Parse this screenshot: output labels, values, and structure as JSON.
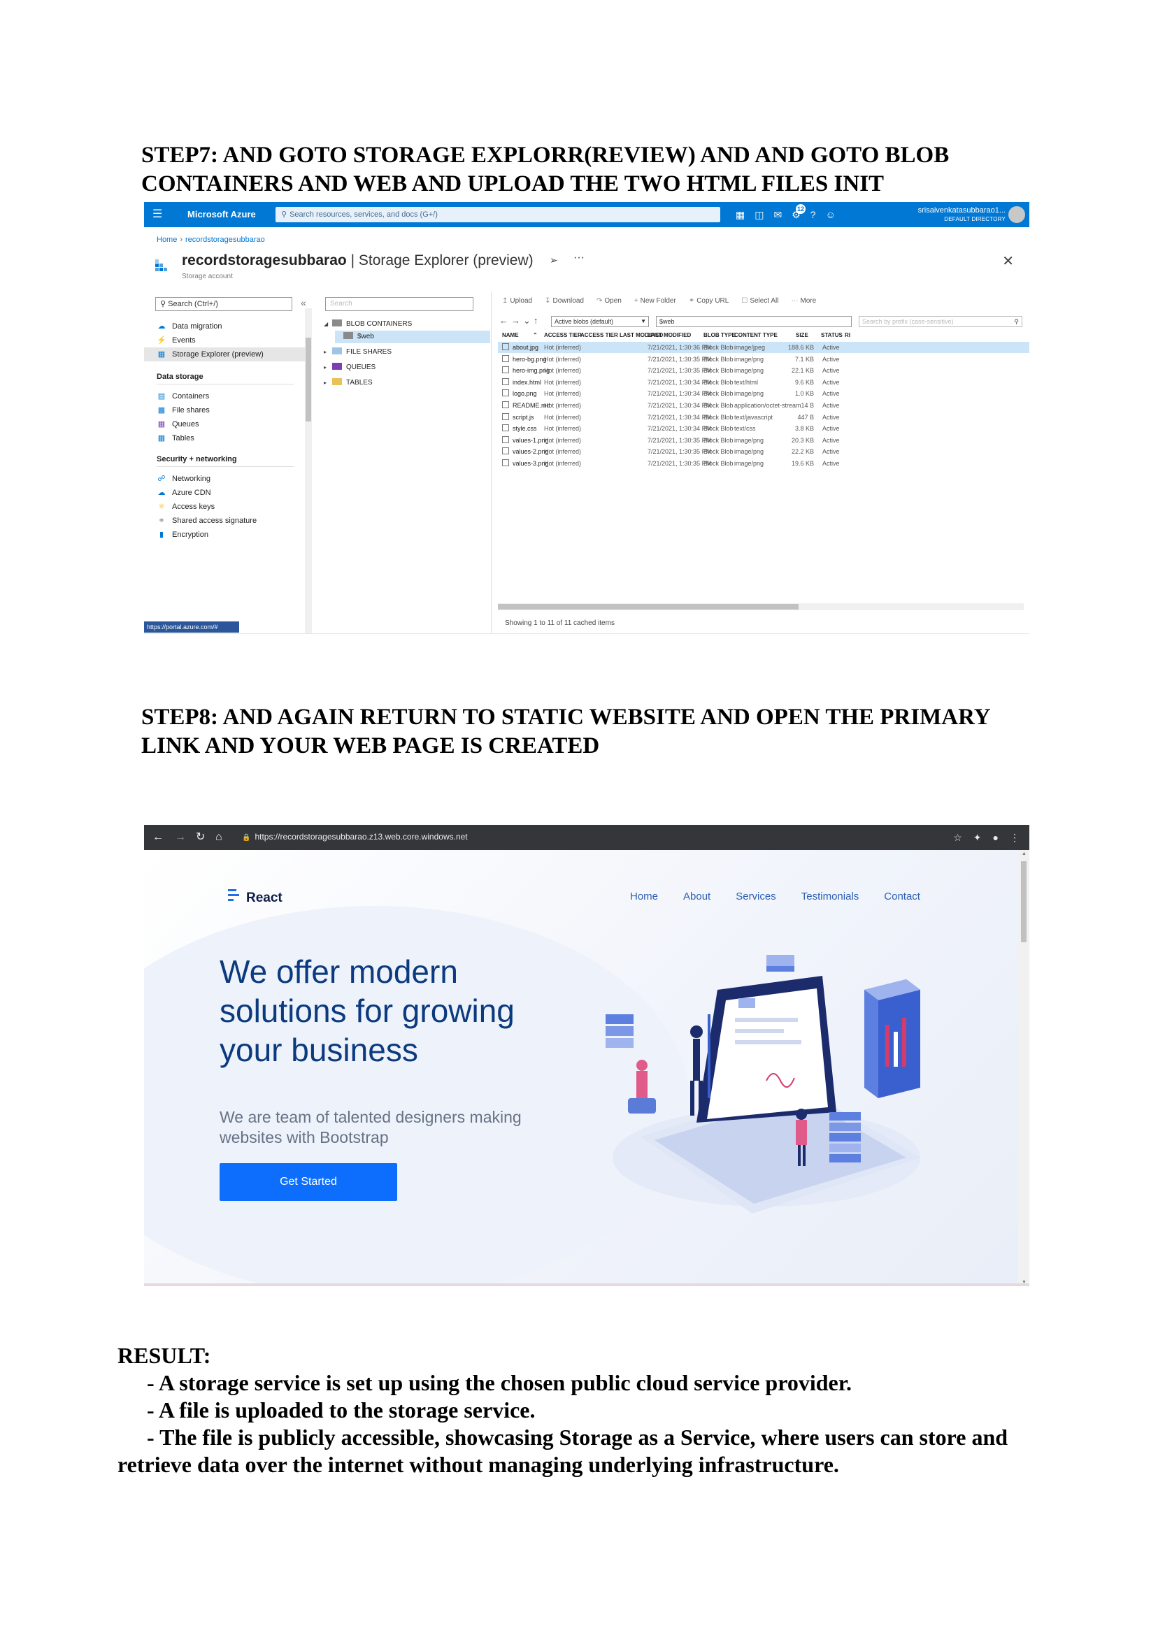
{
  "step7": {
    "line1": "STEP7: AND GOTO STORAGE EXPLORR(REVIEW) AND AND GOTO BLOB",
    "line2": "CONTAINERS AND WEB AND UPLOAD THE TWO HTML FILES INIT"
  },
  "azure": {
    "brand": "Microsoft Azure",
    "search_placeholder": "Search resources, services, and docs (G+/)",
    "notification_count": "12",
    "user_name": "srisaivenkatasubbarao1...",
    "user_directory": "DEFAULT DIRECTORY",
    "breadcrumb": [
      "Home",
      "recordstoragesubbarao"
    ],
    "title_bold": "recordstoragesubbarao",
    "title_rest": " | Storage Explorer (preview)",
    "subtitle": "Storage account",
    "left_search": "Search (Ctrl+/)",
    "menu": {
      "data_migration": "Data migration",
      "events": "Events",
      "storage_explorer": "Storage Explorer (preview)",
      "section_data_storage": "Data storage",
      "containers": "Containers",
      "file_shares": "File shares",
      "queues": "Queues",
      "tables": "Tables",
      "section_security": "Security + networking",
      "networking": "Networking",
      "azure_cdn": "Azure CDN",
      "access_keys": "Access keys",
      "shared_access_signature": "Shared access signature",
      "encryption": "Encryption"
    },
    "status_url": "https://portal.azure.com/#",
    "tree_search": "Search",
    "tree": {
      "blob_containers": "BLOB CONTAINERS",
      "web": "$web",
      "file_shares": "FILE SHARES",
      "queues": "QUEUES",
      "tables": "TABLES"
    },
    "toolbar": {
      "upload": "Upload",
      "download": "Download",
      "open": "Open",
      "new_folder": "New Folder",
      "copy_url": "Copy URL",
      "select_all": "Select All",
      "more": "More"
    },
    "blob_filter": "Active blobs (default)",
    "path": "$web",
    "prefix_placeholder": "Search by prefix (case-sensitive)",
    "columns": {
      "name": "NAME",
      "access_tier": "ACCESS TIER",
      "access_tier_modified": "ACCESS TIER LAST MODIFIED",
      "last_modified": "LAST MODIFIED",
      "blob_type": "BLOB TYPE",
      "content_type": "CONTENT TYPE",
      "size": "SIZE",
      "status": "STATUS",
      "extra": "RI"
    },
    "files": [
      {
        "name": "about.jpg",
        "tier": "Hot (inferred)",
        "modified": "7/21/2021, 1:30:36 PM",
        "type": "Block Blob",
        "content": "image/jpeg",
        "size": "188.6 KB",
        "status": "Active"
      },
      {
        "name": "hero-bg.png",
        "tier": "Hot (inferred)",
        "modified": "7/21/2021, 1:30:35 PM",
        "type": "Block Blob",
        "content": "image/png",
        "size": "7.1 KB",
        "status": "Active"
      },
      {
        "name": "hero-img.png",
        "tier": "Hot (inferred)",
        "modified": "7/21/2021, 1:30:35 PM",
        "type": "Block Blob",
        "content": "image/png",
        "size": "22.1 KB",
        "status": "Active"
      },
      {
        "name": "index.html",
        "tier": "Hot (inferred)",
        "modified": "7/21/2021, 1:30:34 PM",
        "type": "Block Blob",
        "content": "text/html",
        "size": "9.6 KB",
        "status": "Active"
      },
      {
        "name": "logo.png",
        "tier": "Hot (inferred)",
        "modified": "7/21/2021, 1:30:34 PM",
        "type": "Block Blob",
        "content": "image/png",
        "size": "1.0 KB",
        "status": "Active"
      },
      {
        "name": "README.md",
        "tier": "Hot (inferred)",
        "modified": "7/21/2021, 1:30:34 PM",
        "type": "Block Blob",
        "content": "application/octet-stream",
        "size": "14 B",
        "status": "Active"
      },
      {
        "name": "script.js",
        "tier": "Hot (inferred)",
        "modified": "7/21/2021, 1:30:34 PM",
        "type": "Block Blob",
        "content": "text/javascript",
        "size": "447 B",
        "status": "Active"
      },
      {
        "name": "style.css",
        "tier": "Hot (inferred)",
        "modified": "7/21/2021, 1:30:34 PM",
        "type": "Block Blob",
        "content": "text/css",
        "size": "3.8 KB",
        "status": "Active"
      },
      {
        "name": "values-1.png",
        "tier": "Hot (inferred)",
        "modified": "7/21/2021, 1:30:35 PM",
        "type": "Block Blob",
        "content": "image/png",
        "size": "20.3 KB",
        "status": "Active"
      },
      {
        "name": "values-2.png",
        "tier": "Hot (inferred)",
        "modified": "7/21/2021, 1:30:35 PM",
        "type": "Block Blob",
        "content": "image/png",
        "size": "22.2 KB",
        "status": "Active"
      },
      {
        "name": "values-3.png",
        "tier": "Hot (inferred)",
        "modified": "7/21/2021, 1:30:35 PM",
        "type": "Block Blob",
        "content": "image/png",
        "size": "19.6 KB",
        "status": "Active"
      }
    ],
    "footer_status": "Showing 1 to 11 of 11 cached items"
  },
  "step8": {
    "line1": "STEP8: AND AGAIN RETURN TO STATIC WEBSITE AND OPEN  THE PRIMARY",
    "line2": "LINK AND YOUR WEB PAGE IS CREATED"
  },
  "browser": {
    "url": "https://recordstoragesubbarao.z13.web.core.windows.net",
    "logo": "React",
    "nav": [
      "Home",
      "About",
      "Services",
      "Testimonials",
      "Contact"
    ],
    "hero_lines": [
      "We offer modern",
      "solutions for growing",
      "your business"
    ],
    "sub_lines": [
      "We are team of talented designers making",
      "websites with Bootstrap"
    ],
    "cta": "Get Started"
  },
  "result": {
    "title": "RESULT:",
    "point1": "- A storage service is set up using the chosen public cloud service provider.",
    "point2": "- A file is uploaded to the storage service.",
    "point3a": "- The file is publicly accessible, showcasing Storage as a Service, where users can store and",
    "point3b": "retrieve data over the internet without managing underlying infrastructure."
  },
  "colors": {
    "azure_blue": "#0078d4",
    "selection": "#cce4f7",
    "button_blue": "#0d6efd",
    "hero_text": "#0b3a7e"
  }
}
